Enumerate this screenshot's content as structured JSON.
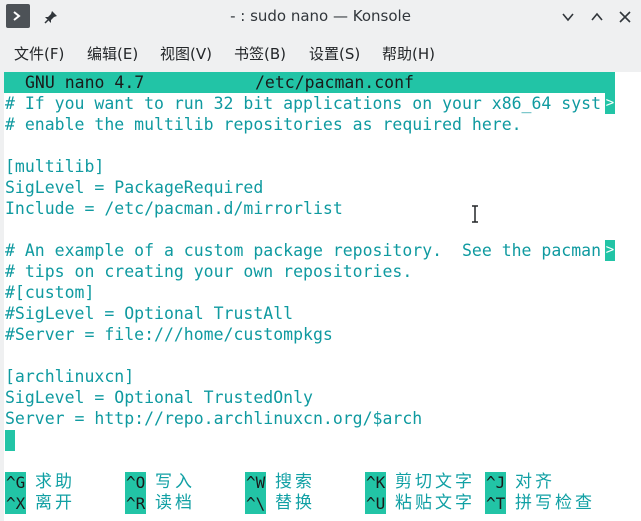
{
  "window": {
    "title": "- : sudo nano — Konsole",
    "icons": [
      "terminal-icon",
      "pin-icon",
      "chevron-down-icon",
      "chevron-up-icon",
      "close-icon"
    ]
  },
  "menubar": {
    "items": [
      "文件(F)",
      "编辑(E)",
      "视图(V)",
      "书签(B)",
      "设置(S)",
      "帮助(H)"
    ]
  },
  "editor": {
    "app": "GNU nano 4.7",
    "filename": "/etc/pacman.conf",
    "lines": [
      "# If you want to run 32 bit applications on your x86_64 syst",
      "# enable the multilib repositories as required here.",
      "",
      "[multilib]",
      "SigLevel = PackageRequired",
      "Include = /etc/pacman.d/mirrorlist",
      "",
      "# An example of a custom package repository.  See the pacman",
      "# tips on creating your own repositories.",
      "#[custom]",
      "#SigLevel = Optional TrustAll",
      "#Server = file:///home/custompkgs",
      "",
      "[archlinuxcn]",
      "SigLevel = Optional TrustedOnly",
      "Server = http://repo.archlinuxcn.org/$arch"
    ],
    "truncation_marker": ">"
  },
  "shortcuts": [
    {
      "key": "^G",
      "label": "求助"
    },
    {
      "key": "^O",
      "label": "写入"
    },
    {
      "key": "^W",
      "label": "搜索"
    },
    {
      "key": "^K",
      "label": "剪切文字"
    },
    {
      "key": "^J",
      "label": "对齐"
    },
    {
      "key": "^X",
      "label": "离开"
    },
    {
      "key": "^R",
      "label": "读档"
    },
    {
      "key": "^\\",
      "label": "替换"
    },
    {
      "key": "^U",
      "label": "粘贴文字"
    },
    {
      "key": "^T",
      "label": "拼写检查"
    }
  ],
  "colors": {
    "accent": "#22c4a6",
    "comment_text": "#0f9aa0",
    "window_bg": "#eff0f1"
  }
}
